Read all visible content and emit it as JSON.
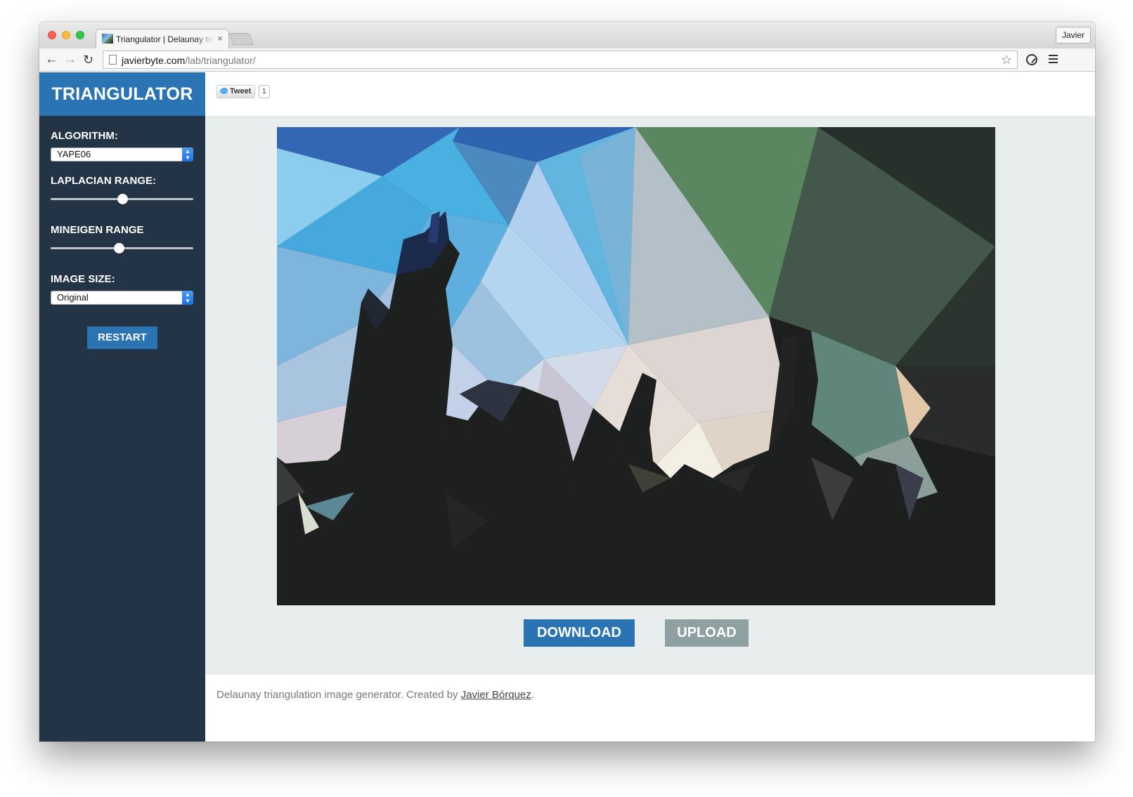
{
  "browser": {
    "tab_title": "Triangulator | Delaunay triangulation",
    "tab_close": "×",
    "profile_name": "Javier",
    "url_host": "javierbyte.com",
    "url_path": "/lab/triangulator/",
    "back_glyph": "←",
    "forward_glyph": "→",
    "reload_glyph": "C",
    "star_glyph": "☆"
  },
  "sidebar": {
    "title": "TRIANGULATOR",
    "algorithm_label": "ALGORITHM:",
    "algorithm_value": "YAPE06",
    "laplacian_label": "LAPLACIAN RANGE:",
    "laplacian_value": 0.5,
    "mineigen_label": "MINEIGEN RANGE",
    "mineigen_value": 0.48,
    "image_size_label": "IMAGE SIZE:",
    "image_size_value": "Original",
    "restart_label": "RESTART",
    "caret_glyph": "▲▼"
  },
  "social": {
    "tweet_label": "Tweet",
    "tweet_count": "1"
  },
  "actions": {
    "download_label": "DOWNLOAD",
    "upload_label": "UPLOAD"
  },
  "footer": {
    "text": "Delaunay triangulation image generator. Created by ",
    "link_text": "Javier Bórquez",
    "end": "."
  },
  "colors": {
    "accent": "#2a74b3",
    "sidebar_bg": "#243447",
    "upload_bg": "#8fa0a2",
    "content_bg": "#e8eeee"
  }
}
